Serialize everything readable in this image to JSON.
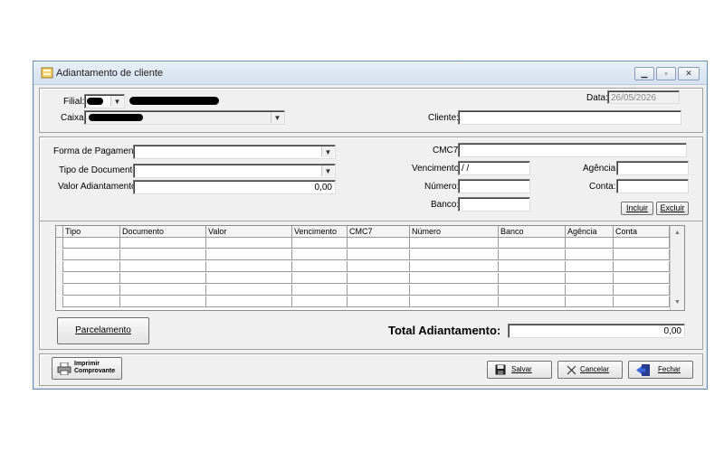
{
  "window": {
    "title": "Adiantamento de cliente",
    "controls": [
      "▁",
      "▫",
      "✕"
    ]
  },
  "header": {
    "filial_label": "Filial:",
    "caixa_label": "Caixa:",
    "data_label": "Data:",
    "data_value": "26/05/2026",
    "cliente_label": "Cliente:",
    "cliente_value": ""
  },
  "payment": {
    "forma_label": "Forma de Pagamento:",
    "tipo_label": "Tipo de Documento:",
    "valor_label": "Valor Adiantamento:",
    "valor_value": "0,00",
    "cmc7_label": "CMC7:",
    "vencimento_label": "Vencimento:",
    "vencimento_value": " / /",
    "numero_label": "Número:",
    "banco_label": "Banco:",
    "agencia_label": "Agência:",
    "conta_label": "Conta:",
    "incluir_label": "Incluir",
    "excluir_label": "Excluir"
  },
  "grid": {
    "columns": [
      "Tipo",
      "Documento",
      "Valor",
      "Vencimento",
      "CMC7",
      "Número",
      "Banco",
      "Agência",
      "Conta"
    ],
    "row_count": 6
  },
  "footer": {
    "parcelamento_label": "Parcelamento",
    "total_label": "Total Adiantamento:",
    "total_value": "0,00",
    "imprimir_label": "Imprimir Comprovante",
    "salvar_label": "Salvar",
    "cancelar_label": "Cancelar",
    "fechar_label": "Fechar"
  }
}
